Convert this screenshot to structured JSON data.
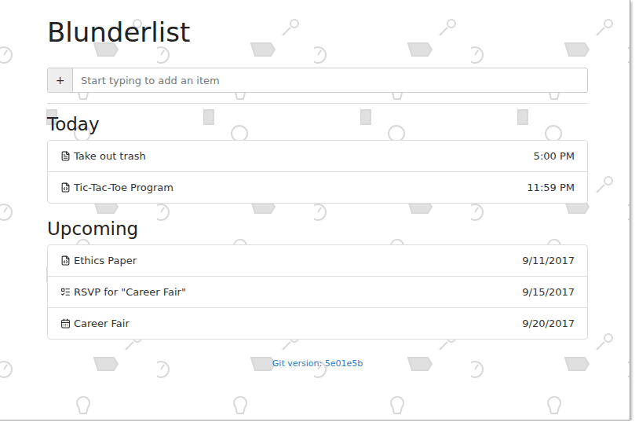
{
  "app": {
    "title": "Blunderlist"
  },
  "add_item": {
    "button": "+",
    "placeholder": "Start typing to add an item"
  },
  "sections": [
    {
      "title": "Today",
      "items": [
        {
          "label": "Take out trash",
          "when": "5:00 PM",
          "kind": "note"
        },
        {
          "label": "Tic-Tac-Toe Program",
          "when": "11:59 PM",
          "kind": "code"
        }
      ]
    },
    {
      "title": "Upcoming",
      "items": [
        {
          "label": "Ethics Paper",
          "when": "9/11/2017",
          "kind": "code"
        },
        {
          "label": "RSVP for \"Career Fair\"",
          "when": "9/15/2017",
          "kind": "rsvp"
        },
        {
          "label": "Career Fair",
          "when": "9/20/2017",
          "kind": "event"
        }
      ]
    }
  ],
  "footer": {
    "version": "Git version: 5e01e5b"
  }
}
